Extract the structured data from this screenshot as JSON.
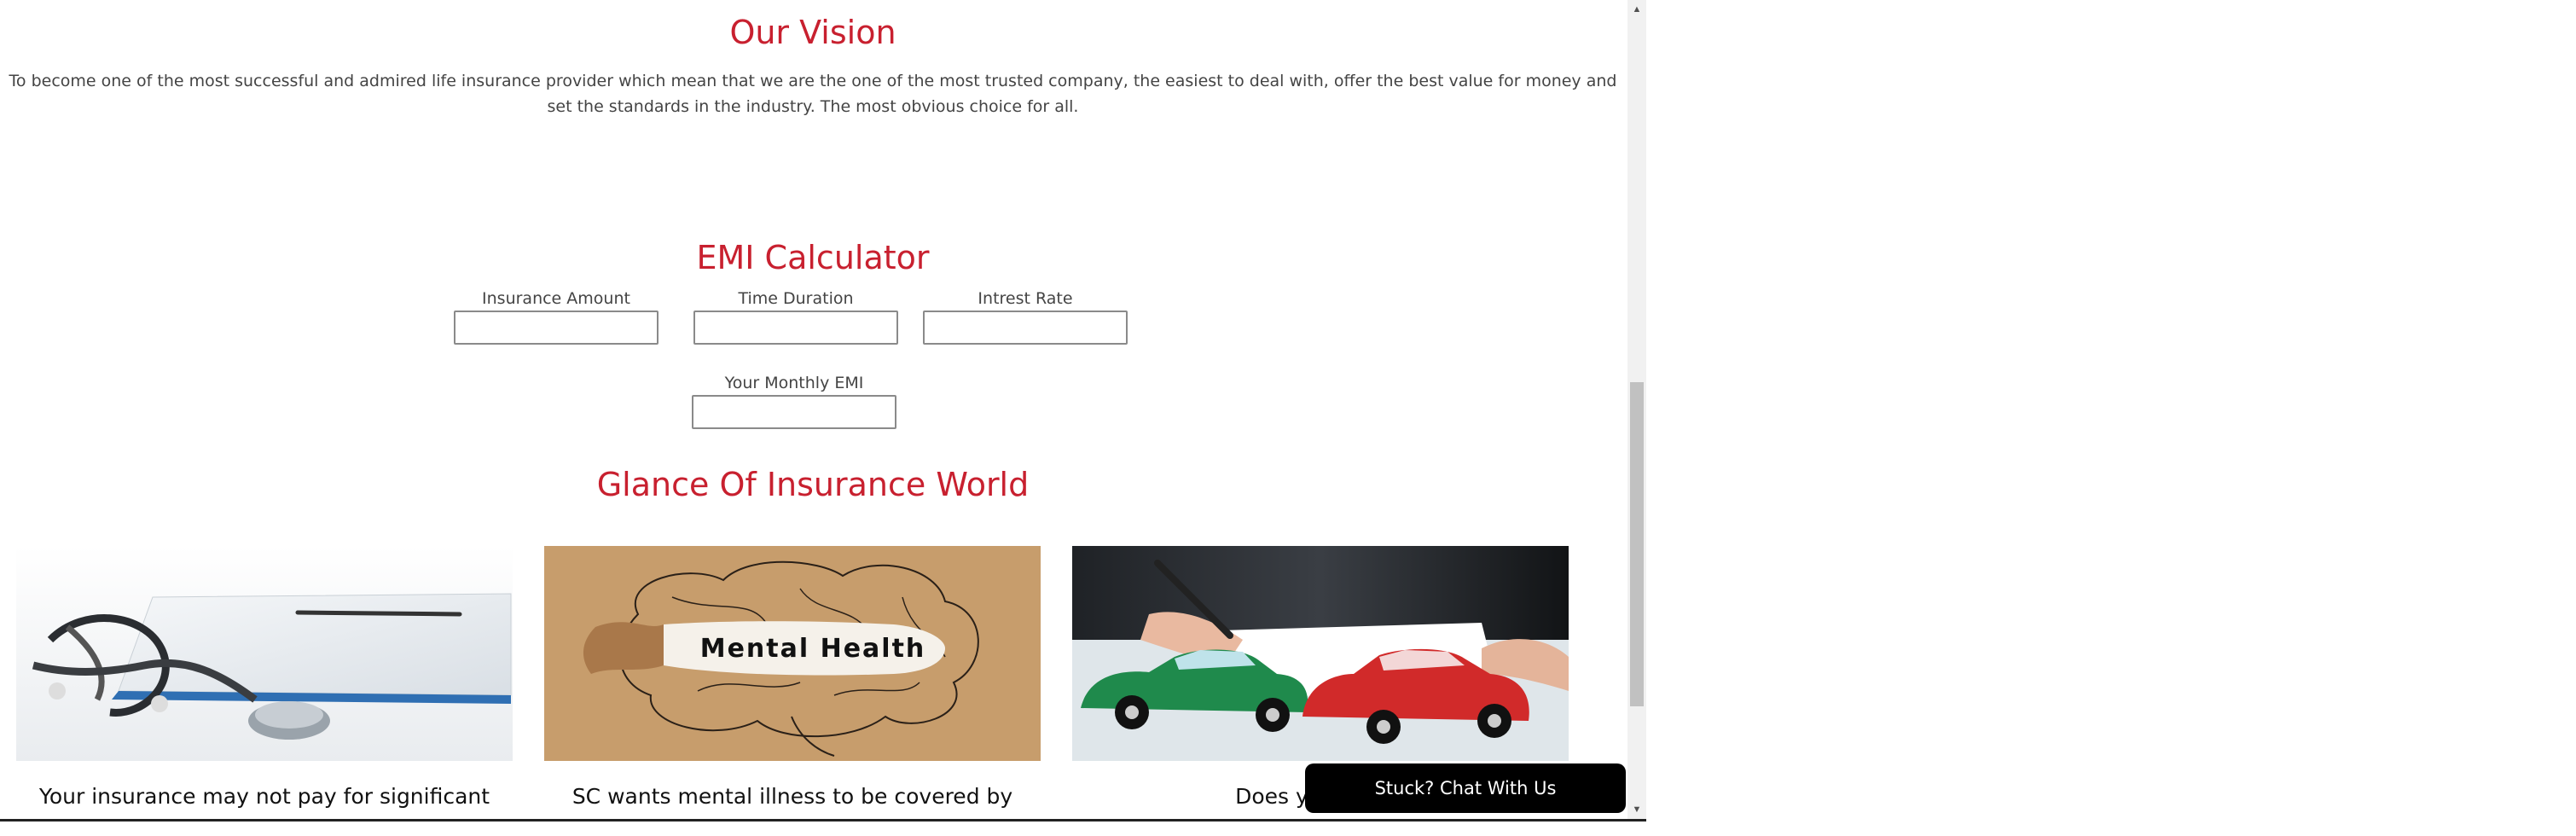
{
  "vision": {
    "heading": "Our Vision",
    "text": "To become one of the most successful and admired life insurance provider which mean that we are the one of the most trusted company, the easiest to deal with, offer the best value for money and set the standards in the industry. The most obvious choice for all."
  },
  "emi": {
    "heading": "EMI Calculator",
    "amount_label": "Insurance Amount",
    "duration_label": "Time Duration",
    "rate_label": "Intrest Rate",
    "monthly_label": "Your Monthly EMI",
    "amount_value": "",
    "duration_value": "",
    "rate_value": "",
    "monthly_value": ""
  },
  "glance": {
    "heading": "Glance Of Insurance World",
    "cards": [
      {
        "image": "stethoscope-clipboard-image",
        "title": "Your insurance may not pay for significant"
      },
      {
        "image": "mental-health-brain-image",
        "title": "SC wants mental illness to be covered by",
        "image_text": "Mental Health"
      },
      {
        "image": "toy-cars-collision-image",
        "title": "Does your moto"
      }
    ]
  },
  "chat": {
    "label": "Stuck? Chat With Us"
  },
  "colors": {
    "accent": "#c8202f",
    "text": "#444444",
    "chat_bg": "#000000"
  }
}
